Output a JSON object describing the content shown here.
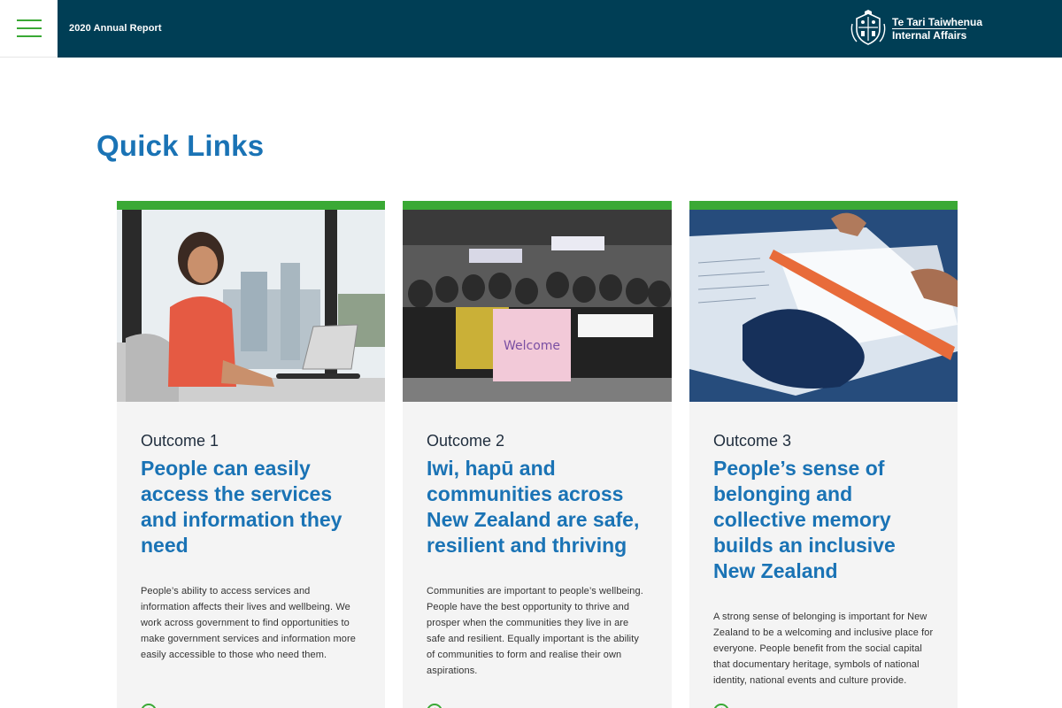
{
  "header": {
    "title": "2020 Annual Report",
    "brand_line1": "Te Tari Taiwhenua",
    "brand_line2": "Internal Affairs",
    "menu_icon": "hamburger-icon",
    "crest_icon": "crest-icon"
  },
  "colors": {
    "navy": "#003e55",
    "accent_green": "#3aa935",
    "title_blue": "#1a73b5",
    "card_bg": "#f4f4f4"
  },
  "section": {
    "title": "Quick Links"
  },
  "cards": [
    {
      "label": "Outcome 1",
      "title": "People can easily access the services and information they need",
      "description": "People’s ability to access services and information affects their lives and wellbeing. We work across government to find opportunities to make government services and information more easily accessible to those who need them."
    },
    {
      "label": "Outcome 2",
      "title": "Iwi, hapū and communities across New Zealand are safe, resilient and thriving",
      "description": "Communities are important to people’s wellbeing. People have the best opportunity to thrive and prosper when the communities they live in are safe and resilient. Equally important is the ability of communities to form and realise their own aspirations."
    },
    {
      "label": "Outcome 3",
      "title": "People’s sense of belonging and collective memory builds an inclusive New Zealand",
      "description": "A strong sense of belonging is important for New Zealand to be a welcoming and inclusive place for everyone. People benefit from the social capital that documentary heritage, symbols of national identity, national events and culture provide."
    }
  ]
}
